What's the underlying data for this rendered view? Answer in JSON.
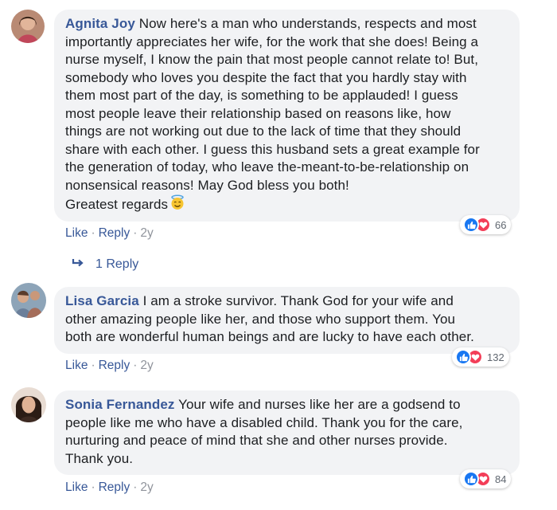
{
  "comments": [
    {
      "author": "Agnita Joy",
      "text_lines": [
        "Now here's a man who understands, respects and most",
        "importantly appreciates her wife, for the work that she does! Being a",
        "nurse myself, I know the pain that most people cannot relate to! But,",
        "somebody who loves you despite the fact that you hardly stay with",
        "them most part of the day, is something to be applauded! I guess",
        "most people leave their relationship based on reasons like, how",
        "things are not working out due to the lack of time that they should",
        "share with each other. I guess this husband sets a great example for",
        "the generation of today, who leave the-meant-to-be-relationship on",
        "nonsensical reasons! May God bless you both!",
        "Greatest regards"
      ],
      "reaction_count": "66",
      "like_label": "Like",
      "reply_label": "Reply",
      "time": "2y",
      "replies_label": "1 Reply"
    },
    {
      "author": "Lisa Garcia",
      "text_lines": [
        "I am a stroke survivor. Thank God for your wife and",
        "other amazing people like her, and those who support them. You",
        "both are wonderful human beings and are lucky to have each other."
      ],
      "reaction_count": "132",
      "like_label": "Like",
      "reply_label": "Reply",
      "time": "2y"
    },
    {
      "author": "Sonia Fernandez",
      "text_lines": [
        "Your wife and nurses like her are a godsend to",
        "people like me who have a disabled child. Thank you for the care,",
        "nurturing and peace of mind that she and other nurses provide.",
        "Thank you."
      ],
      "reaction_count": "84",
      "like_label": "Like",
      "reply_label": "Reply",
      "time": "2y"
    }
  ],
  "colors": {
    "bubble": "#f2f3f5",
    "author": "#385898",
    "meta": "#90949c",
    "like": "#1877f2",
    "love": "#f33e58"
  },
  "icons": [
    "like-reaction-icon",
    "love-reaction-icon",
    "reply-arrow-icon",
    "angel-emoji-icon"
  ]
}
